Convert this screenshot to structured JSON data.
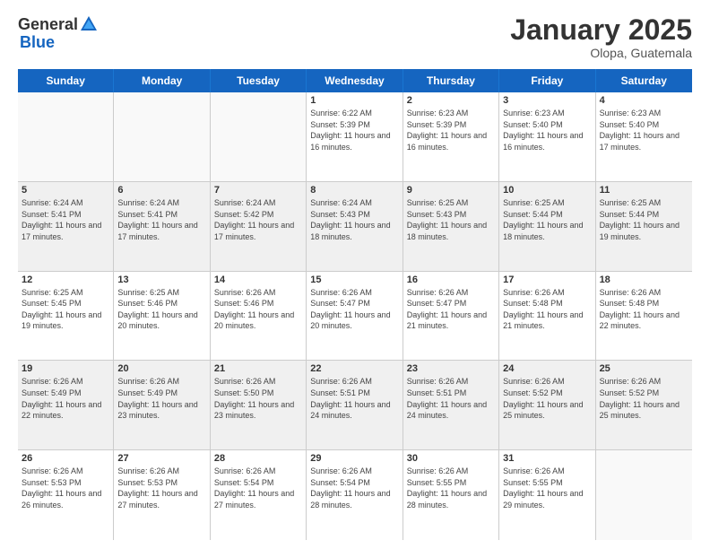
{
  "header": {
    "logo_general": "General",
    "logo_blue": "Blue",
    "month": "January 2025",
    "location": "Olopa, Guatemala"
  },
  "weekdays": [
    "Sunday",
    "Monday",
    "Tuesday",
    "Wednesday",
    "Thursday",
    "Friday",
    "Saturday"
  ],
  "weeks": [
    [
      {
        "day": "",
        "info": ""
      },
      {
        "day": "",
        "info": ""
      },
      {
        "day": "",
        "info": ""
      },
      {
        "day": "1",
        "info": "Sunrise: 6:22 AM\nSunset: 5:39 PM\nDaylight: 11 hours\nand 16 minutes."
      },
      {
        "day": "2",
        "info": "Sunrise: 6:23 AM\nSunset: 5:39 PM\nDaylight: 11 hours\nand 16 minutes."
      },
      {
        "day": "3",
        "info": "Sunrise: 6:23 AM\nSunset: 5:40 PM\nDaylight: 11 hours\nand 16 minutes."
      },
      {
        "day": "4",
        "info": "Sunrise: 6:23 AM\nSunset: 5:40 PM\nDaylight: 11 hours\nand 17 minutes."
      }
    ],
    [
      {
        "day": "5",
        "info": "Sunrise: 6:24 AM\nSunset: 5:41 PM\nDaylight: 11 hours\nand 17 minutes."
      },
      {
        "day": "6",
        "info": "Sunrise: 6:24 AM\nSunset: 5:41 PM\nDaylight: 11 hours\nand 17 minutes."
      },
      {
        "day": "7",
        "info": "Sunrise: 6:24 AM\nSunset: 5:42 PM\nDaylight: 11 hours\nand 17 minutes."
      },
      {
        "day": "8",
        "info": "Sunrise: 6:24 AM\nSunset: 5:43 PM\nDaylight: 11 hours\nand 18 minutes."
      },
      {
        "day": "9",
        "info": "Sunrise: 6:25 AM\nSunset: 5:43 PM\nDaylight: 11 hours\nand 18 minutes."
      },
      {
        "day": "10",
        "info": "Sunrise: 6:25 AM\nSunset: 5:44 PM\nDaylight: 11 hours\nand 18 minutes."
      },
      {
        "day": "11",
        "info": "Sunrise: 6:25 AM\nSunset: 5:44 PM\nDaylight: 11 hours\nand 19 minutes."
      }
    ],
    [
      {
        "day": "12",
        "info": "Sunrise: 6:25 AM\nSunset: 5:45 PM\nDaylight: 11 hours\nand 19 minutes."
      },
      {
        "day": "13",
        "info": "Sunrise: 6:25 AM\nSunset: 5:46 PM\nDaylight: 11 hours\nand 20 minutes."
      },
      {
        "day": "14",
        "info": "Sunrise: 6:26 AM\nSunset: 5:46 PM\nDaylight: 11 hours\nand 20 minutes."
      },
      {
        "day": "15",
        "info": "Sunrise: 6:26 AM\nSunset: 5:47 PM\nDaylight: 11 hours\nand 20 minutes."
      },
      {
        "day": "16",
        "info": "Sunrise: 6:26 AM\nSunset: 5:47 PM\nDaylight: 11 hours\nand 21 minutes."
      },
      {
        "day": "17",
        "info": "Sunrise: 6:26 AM\nSunset: 5:48 PM\nDaylight: 11 hours\nand 21 minutes."
      },
      {
        "day": "18",
        "info": "Sunrise: 6:26 AM\nSunset: 5:48 PM\nDaylight: 11 hours\nand 22 minutes."
      }
    ],
    [
      {
        "day": "19",
        "info": "Sunrise: 6:26 AM\nSunset: 5:49 PM\nDaylight: 11 hours\nand 22 minutes."
      },
      {
        "day": "20",
        "info": "Sunrise: 6:26 AM\nSunset: 5:49 PM\nDaylight: 11 hours\nand 23 minutes."
      },
      {
        "day": "21",
        "info": "Sunrise: 6:26 AM\nSunset: 5:50 PM\nDaylight: 11 hours\nand 23 minutes."
      },
      {
        "day": "22",
        "info": "Sunrise: 6:26 AM\nSunset: 5:51 PM\nDaylight: 11 hours\nand 24 minutes."
      },
      {
        "day": "23",
        "info": "Sunrise: 6:26 AM\nSunset: 5:51 PM\nDaylight: 11 hours\nand 24 minutes."
      },
      {
        "day": "24",
        "info": "Sunrise: 6:26 AM\nSunset: 5:52 PM\nDaylight: 11 hours\nand 25 minutes."
      },
      {
        "day": "25",
        "info": "Sunrise: 6:26 AM\nSunset: 5:52 PM\nDaylight: 11 hours\nand 25 minutes."
      }
    ],
    [
      {
        "day": "26",
        "info": "Sunrise: 6:26 AM\nSunset: 5:53 PM\nDaylight: 11 hours\nand 26 minutes."
      },
      {
        "day": "27",
        "info": "Sunrise: 6:26 AM\nSunset: 5:53 PM\nDaylight: 11 hours\nand 27 minutes."
      },
      {
        "day": "28",
        "info": "Sunrise: 6:26 AM\nSunset: 5:54 PM\nDaylight: 11 hours\nand 27 minutes."
      },
      {
        "day": "29",
        "info": "Sunrise: 6:26 AM\nSunset: 5:54 PM\nDaylight: 11 hours\nand 28 minutes."
      },
      {
        "day": "30",
        "info": "Sunrise: 6:26 AM\nSunset: 5:55 PM\nDaylight: 11 hours\nand 28 minutes."
      },
      {
        "day": "31",
        "info": "Sunrise: 6:26 AM\nSunset: 5:55 PM\nDaylight: 11 hours\nand 29 minutes."
      },
      {
        "day": "",
        "info": ""
      }
    ]
  ]
}
